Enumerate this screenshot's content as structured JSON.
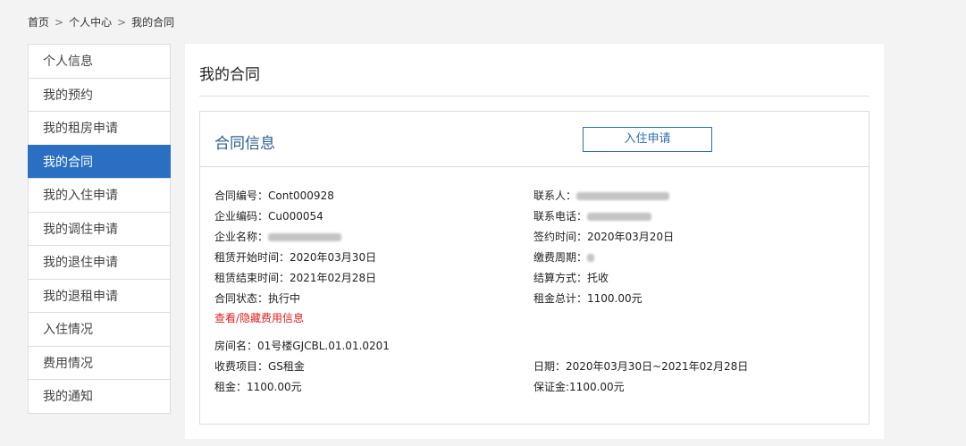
{
  "breadcrumb": {
    "home": "首页",
    "sep1": ">",
    "center": "个人中心",
    "sep2": ">",
    "current": "我的合同"
  },
  "sidebar": {
    "items": [
      {
        "label": "个人信息"
      },
      {
        "label": "我的预约"
      },
      {
        "label": "我的租房申请"
      },
      {
        "label": "我的合同"
      },
      {
        "label": "我的入住申请"
      },
      {
        "label": "我的调住申请"
      },
      {
        "label": "我的退住申请"
      },
      {
        "label": "我的退租申请"
      },
      {
        "label": "入住情况"
      },
      {
        "label": "费用情况"
      },
      {
        "label": "我的通知"
      }
    ]
  },
  "main": {
    "title": "我的合同",
    "card": {
      "title": "合同信息",
      "apply_button": "入住申请",
      "left": {
        "contract_no": "合同编号：Cont000928",
        "company_code": "企业编码：Cu000054",
        "company_name_label": "企业名称：",
        "start": "租赁开始时间：2020年03月30日",
        "end": "租赁结束时间：2021年02月28日",
        "status": "合同状态：执行中",
        "toggle_fee": "查看/隐藏费用信息",
        "room": "房间名：01号楼GJCBL.01.01.0201",
        "fee_item": "收费项目：GS租金",
        "rent": "租金：1100.00元"
      },
      "right": {
        "contact_label": "联系人：",
        "phone_label": "联系电话：",
        "sign_date": "签约时间：2020年03月20日",
        "pay_cycle_label": "缴费周期：",
        "settle": "结算方式：托收",
        "rent_total": "租金总计：1100.00元",
        "date_range": "日期：2020年03月30日~2021年02月28日",
        "deposit": "保证金:1100.00元"
      }
    }
  },
  "colors": {
    "accent": "#2a6fc1",
    "link_red": "#e02020",
    "title_blue": "#2d5e91"
  }
}
